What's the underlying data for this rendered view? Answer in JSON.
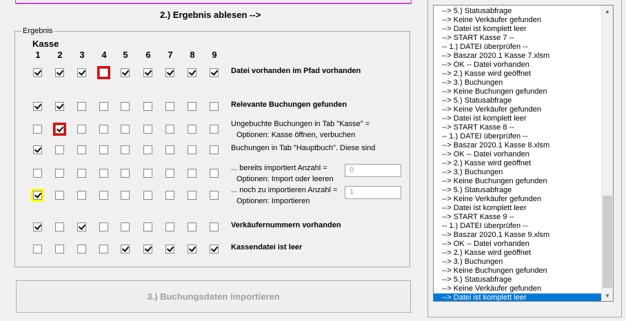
{
  "header": {
    "step2_label": "2.) Ergebnis ablesen -->"
  },
  "ergebnis": {
    "legend": "Ergebnis",
    "kasse_title": "Kasse",
    "columns": [
      "1",
      "2",
      "3",
      "4",
      "5",
      "6",
      "7",
      "8",
      "9"
    ],
    "rows": [
      {
        "label": "Datei vorhanden im Pfad vorhanden",
        "bold": true,
        "checks": [
          true,
          true,
          true,
          false,
          true,
          true,
          true,
          true,
          true
        ]
      },
      {
        "label": "Relevante Buchungen gefunden",
        "bold": true,
        "checks": [
          true,
          true,
          false,
          false,
          false,
          false,
          false,
          false,
          false
        ]
      },
      {
        "label": "Ungebuchte Buchungen in Tab \"Kasse\" =",
        "sub": "Optionen: Kasse öffnen, verbuchen",
        "bold": false,
        "checks": [
          false,
          true,
          false,
          false,
          false,
          false,
          false,
          false,
          false
        ]
      },
      {
        "label": "Buchungen in Tab \"Hauptbuch\". Diese sind",
        "bold": false,
        "checks": [
          true,
          false,
          false,
          false,
          false,
          false,
          false,
          false,
          false
        ]
      },
      {
        "label": "... bereits importiert    Anzahl =",
        "sub": "Optionen: Import oder leeren",
        "bold": false,
        "checks": [
          false,
          false,
          false,
          false,
          false,
          false,
          false,
          false,
          false
        ],
        "count": "0"
      },
      {
        "label": "... noch zu importieren Anzahl =",
        "sub": "Optionen: Importieren",
        "bold": false,
        "checks": [
          true,
          false,
          false,
          false,
          false,
          false,
          false,
          false,
          false
        ],
        "count": "1"
      },
      {
        "label": "Verkäufernummern vorhanden",
        "bold": true,
        "checks": [
          true,
          false,
          true,
          false,
          false,
          false,
          false,
          false,
          false
        ]
      },
      {
        "label": "Kassendatei ist leer",
        "bold": true,
        "checks": [
          false,
          false,
          false,
          false,
          true,
          true,
          true,
          true,
          true
        ]
      }
    ],
    "highlights": [
      {
        "row": 0,
        "col": 3,
        "color": "red"
      },
      {
        "row": 2,
        "col": 1,
        "color": "red"
      },
      {
        "row": 5,
        "col": 0,
        "color": "yellow"
      }
    ]
  },
  "import_button": {
    "label": "3.) Buchungsdaten importieren"
  },
  "log": {
    "items": [
      "--> 5.) Statusabfrage",
      "--> Keine Verkäufer gefunden",
      "--> Datei ist komplett leer",
      "--> START Kasse 7 --",
      "-- 1.) DATEI überprüfen --",
      "--> Baszar 2020.1 Kasse 7.xlsm",
      "--> OK -- Datei vorhanden",
      "--> 2.) Kasse wird geöffnet",
      "--> 3.) Buchungen",
      "--> Keine Buchungen gefunden",
      "--> 5.) Statusabfrage",
      "--> Keine Verkäufer gefunden",
      "--> Datei ist komplett leer",
      "--> START Kasse 8 --",
      "-- 1.) DATEI überprüfen --",
      "--> Baszar 2020.1 Kasse 8.xlsm",
      "--> OK -- Datei vorhanden",
      "--> 2.) Kasse wird geöffnet",
      "--> 3.) Buchungen",
      "--> Keine Buchungen gefunden",
      "--> 5.) Statusabfrage",
      "--> Keine Verkäufer gefunden",
      "--> Datei ist komplett leer",
      "--> START Kasse 9 --",
      "-- 1.) DATEI überprüfen --",
      "--> Baszar 2020.1 Kasse 9.xlsm",
      "--> OK -- Datei vorhanden",
      "--> 2.) Kasse wird geöffnet",
      "--> 3.) Buchungen",
      "--> Keine Buchungen gefunden",
      "--> 5.) Statusabfrage",
      "--> Keine Verkäufer gefunden",
      "--> Datei ist komplett leer"
    ],
    "selected_index": 32
  },
  "colors": {
    "highlight_red": "#e00000",
    "highlight_yellow": "#ffff00",
    "selection": "#0078d7"
  }
}
